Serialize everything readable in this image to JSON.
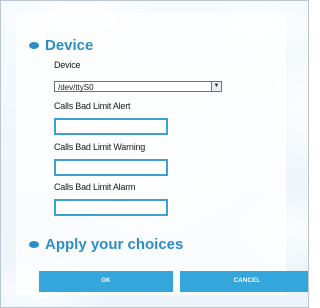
{
  "sections": {
    "device_title": "Device",
    "apply_title": "Apply your choices"
  },
  "fields": {
    "device_label": "Device",
    "device_value": "/dev/ttyS0",
    "alert_label": "Calls Bad Limit Alert",
    "alert_value": "",
    "warning_label": "Calls Bad Limit Warning",
    "warning_value": "",
    "alarm_label": "Calls Bad Limit Alarm",
    "alarm_value": ""
  },
  "buttons": {
    "ok": "OK",
    "cancel": "CANCEL"
  },
  "colors": {
    "accent": "#2b8fc6",
    "button": "#35a6dc",
    "field_border": "#3e9fd3"
  }
}
